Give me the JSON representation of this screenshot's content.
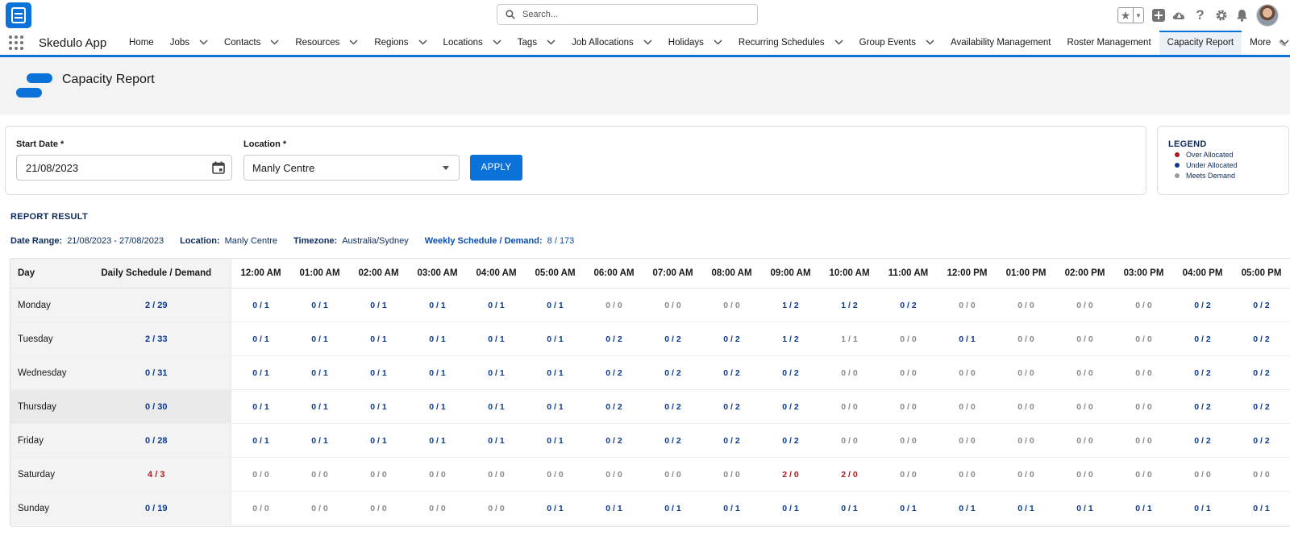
{
  "header": {
    "search_placeholder": "Search...",
    "icons": [
      "favorites-star-icon",
      "chevron-down-icon",
      "add-icon",
      "trailhead-icon",
      "help-icon",
      "setup-gear-icon",
      "notifications-bell-icon"
    ]
  },
  "nav": {
    "app_name": "Skedulo App",
    "items": [
      {
        "label": "Home",
        "chevron": false
      },
      {
        "label": "Jobs",
        "chevron": true
      },
      {
        "label": "Contacts",
        "chevron": true
      },
      {
        "label": "Resources",
        "chevron": true
      },
      {
        "label": "Regions",
        "chevron": true
      },
      {
        "label": "Locations",
        "chevron": true
      },
      {
        "label": "Tags",
        "chevron": true
      },
      {
        "label": "Job Allocations",
        "chevron": true
      },
      {
        "label": "Holidays",
        "chevron": true
      },
      {
        "label": "Recurring Schedules",
        "chevron": true
      },
      {
        "label": "Group Events",
        "chevron": true
      },
      {
        "label": "Availability Management",
        "chevron": false
      },
      {
        "label": "Roster Management",
        "chevron": false
      },
      {
        "label": "Capacity Report",
        "chevron": false,
        "active": true
      },
      {
        "label": "More",
        "chevron": true
      }
    ]
  },
  "page": {
    "title": "Capacity Report"
  },
  "filters": {
    "start_date_label": "Start Date *",
    "start_date_value": "21/08/2023",
    "location_label": "Location *",
    "location_value": "Manly Centre",
    "apply_label": "APPLY"
  },
  "legend": {
    "title": "LEGEND",
    "items": [
      {
        "label": "Over Allocated",
        "color": "#b5171c"
      },
      {
        "label": "Under Allocated",
        "color": "#0d3a91"
      },
      {
        "label": "Meets Demand",
        "color": "#9a9a9a"
      }
    ]
  },
  "report": {
    "title": "REPORT RESULT",
    "summary": [
      {
        "key": "Date Range:",
        "value": "21/08/2023 - 27/08/2023"
      },
      {
        "key": "Location:",
        "value": "Manly Centre"
      },
      {
        "key": "Timezone:",
        "value": "Australia/Sydney"
      },
      {
        "key": "Weekly Schedule / Demand:",
        "value": "8 / 173",
        "accent": true
      }
    ]
  },
  "table": {
    "col_day": "Day",
    "col_daily": "Daily Schedule / Demand",
    "hours": [
      "12:00 AM",
      "01:00 AM",
      "02:00 AM",
      "03:00 AM",
      "04:00 AM",
      "05:00 AM",
      "06:00 AM",
      "07:00 AM",
      "08:00 AM",
      "09:00 AM",
      "10:00 AM",
      "11:00 AM",
      "12:00 PM",
      "01:00 PM",
      "02:00 PM",
      "03:00 PM",
      "04:00 PM",
      "05:00 PM"
    ],
    "rows": [
      {
        "day": "Monday",
        "daily": "2 / 29",
        "cells": [
          "0 / 1",
          "0 / 1",
          "0 / 1",
          "0 / 1",
          "0 / 1",
          "0 / 1",
          "0 / 0",
          "0 / 0",
          "0 / 0",
          "1 / 2",
          "1 / 2",
          "0 / 2",
          "0 / 0",
          "0 / 0",
          "0 / 0",
          "0 / 0",
          "0 / 2",
          "0 / 2"
        ]
      },
      {
        "day": "Tuesday",
        "daily": "2 / 33",
        "cells": [
          "0 / 1",
          "0 / 1",
          "0 / 1",
          "0 / 1",
          "0 / 1",
          "0 / 1",
          "0 / 2",
          "0 / 2",
          "0 / 2",
          "1 / 2",
          "1 / 1",
          "0 / 0",
          "0 / 1",
          "0 / 0",
          "0 / 0",
          "0 / 0",
          "0 / 2",
          "0 / 2"
        ]
      },
      {
        "day": "Wednesday",
        "daily": "0 / 31",
        "cells": [
          "0 / 1",
          "0 / 1",
          "0 / 1",
          "0 / 1",
          "0 / 1",
          "0 / 1",
          "0 / 2",
          "0 / 2",
          "0 / 2",
          "0 / 2",
          "0 / 0",
          "0 / 0",
          "0 / 0",
          "0 / 0",
          "0 / 0",
          "0 / 0",
          "0 / 2",
          "0 / 2"
        ]
      },
      {
        "day": "Thursday",
        "daily": "0 / 30",
        "highlight": true,
        "cells": [
          "0 / 1",
          "0 / 1",
          "0 / 1",
          "0 / 1",
          "0 / 1",
          "0 / 1",
          "0 / 2",
          "0 / 2",
          "0 / 2",
          "0 / 2",
          "0 / 0",
          "0 / 0",
          "0 / 0",
          "0 / 0",
          "0 / 0",
          "0 / 0",
          "0 / 2",
          "0 / 2"
        ]
      },
      {
        "day": "Friday",
        "daily": "0 / 28",
        "cells": [
          "0 / 1",
          "0 / 1",
          "0 / 1",
          "0 / 1",
          "0 / 1",
          "0 / 1",
          "0 / 2",
          "0 / 2",
          "0 / 2",
          "0 / 2",
          "0 / 0",
          "0 / 0",
          "0 / 0",
          "0 / 0",
          "0 / 0",
          "0 / 0",
          "0 / 2",
          "0 / 2"
        ]
      },
      {
        "day": "Saturday",
        "daily": "4 / 3",
        "cells": [
          "0 / 0",
          "0 / 0",
          "0 / 0",
          "0 / 0",
          "0 / 0",
          "0 / 0",
          "0 / 0",
          "0 / 0",
          "0 / 0",
          "2 / 0",
          "2 / 0",
          "0 / 0",
          "0 / 0",
          "0 / 0",
          "0 / 0",
          "0 / 0",
          "0 / 0",
          "0 / 0"
        ]
      },
      {
        "day": "Sunday",
        "daily": "0 / 19",
        "cells": [
          "0 / 0",
          "0 / 0",
          "0 / 0",
          "0 / 0",
          "0 / 0",
          "0 / 1",
          "0 / 1",
          "0 / 1",
          "0 / 1",
          "0 / 1",
          "0 / 1",
          "0 / 1",
          "0 / 1",
          "0 / 1",
          "0 / 1",
          "0 / 1",
          "0 / 1",
          "0 / 1"
        ]
      }
    ]
  }
}
